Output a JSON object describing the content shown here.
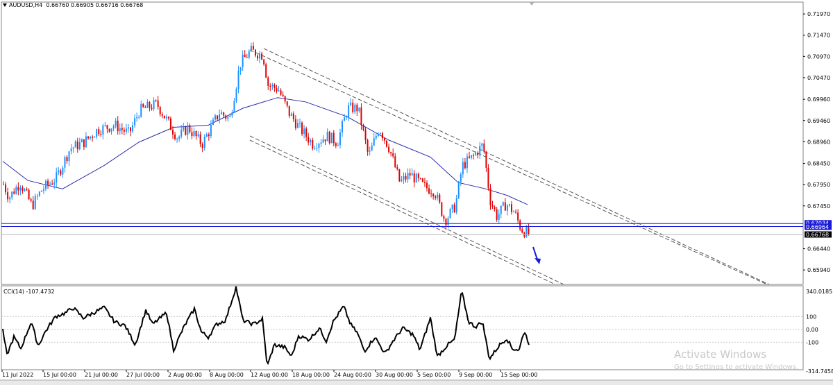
{
  "header": {
    "symbol_label": "AUDUSD,H4",
    "ohlc": "0.66760 0.66905 0.66716 0.66768"
  },
  "indicator": {
    "label": "CCI(14) -107.4732"
  },
  "price_axis": {
    "ticks": [
      "0.71970",
      "0.71470",
      "0.70970",
      "0.70470",
      "0.69960",
      "0.69460",
      "0.68960",
      "0.68450",
      "0.67950",
      "0.67450",
      "0.66440",
      "0.65940"
    ],
    "ticks_values": [
      0.7197,
      0.7147,
      0.7097,
      0.7047,
      0.6996,
      0.6946,
      0.6896,
      0.6845,
      0.6795,
      0.6745,
      0.6644,
      0.6594
    ],
    "price_labels": [
      {
        "text": "0.67034",
        "value": 0.67034,
        "bg": "#1a1ad8",
        "fg": "#ffffff"
      },
      {
        "text": "0.66964",
        "value": 0.66964,
        "bg": "#1a1ad8",
        "fg": "#ffffff"
      },
      {
        "text": "0.66768",
        "value": 0.66768,
        "bg": "#000000",
        "fg": "#ffffff"
      }
    ]
  },
  "cci_axis": {
    "ticks": [
      "340.0185",
      "100",
      "0.00",
      "-100",
      "-314.7458"
    ],
    "ticks_values": [
      340.0185,
      100,
      0,
      -100,
      -314.7458
    ]
  },
  "time_axis": {
    "labels": [
      "11 Jul 2022",
      "15 Jul 00:00",
      "21 Jul 00:00",
      "27 Jul 00:00",
      "2 Aug 00:00",
      "8 Aug 00:00",
      "12 Aug 00:00",
      "18 Aug 00:00",
      "24 Aug 00:00",
      "30 Aug 00:00",
      "5 Sep 00:00",
      "9 Sep 00:00",
      "15 Sep 00:00"
    ]
  },
  "watermark": {
    "title": "Activate Windows",
    "subtitle": "Go to Settings to activate Windows."
  },
  "colors": {
    "bull": "#1e90ff",
    "bear": "#e00000",
    "ma": "#2c2ca8",
    "hline": "#1a1ad8",
    "arrow": "#1a1ad8",
    "cci": "#000000",
    "channel": "#555555"
  },
  "chart_data": {
    "type": "line",
    "symbol": "AUDUSD",
    "timeframe": "H4",
    "ohlc_last": {
      "open": 0.6676,
      "high": 0.66905,
      "low": 0.66716,
      "close": 0.66768
    },
    "ylim": [
      0.656,
      0.7225
    ],
    "series": [
      {
        "name": "AUDUSD",
        "x": [
          "11 Jul 2022",
          "15 Jul 00:00",
          "21 Jul 00:00",
          "27 Jul 00:00",
          "2 Aug 00:00",
          "8 Aug 00:00",
          "12 Aug 00:00",
          "18 Aug 00:00",
          "24 Aug 00:00",
          "30 Aug 00:00",
          "5 Sep 00:00",
          "9 Sep 00:00",
          "15 Sep 00:00"
        ],
        "values": [
          0.677,
          0.68,
          0.688,
          0.696,
          0.693,
          0.697,
          0.708,
          0.69,
          0.696,
          0.68,
          0.673,
          0.688,
          0.669
        ]
      }
    ],
    "horizontal_lines": [
      0.67034,
      0.66964,
      0.66768
    ],
    "cci": {
      "label": "CCI(14)",
      "last": -107.4732,
      "ylim": [
        -314.7458,
        340.0185
      ],
      "levels": [
        100,
        0,
        -100
      ]
    }
  }
}
